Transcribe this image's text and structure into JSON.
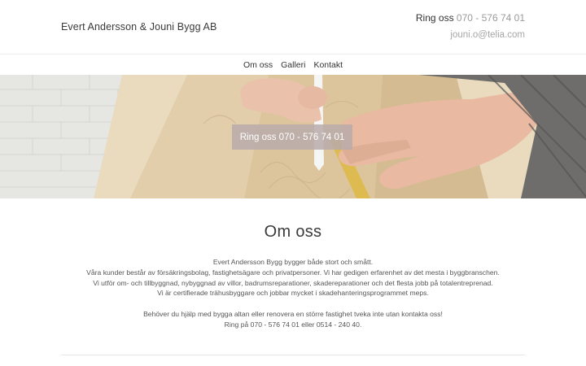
{
  "header": {
    "brand": "Evert Andersson & Jouni Bygg AB",
    "phone_label": "Ring oss",
    "phone_number": "070 - 576 74 01",
    "email": "jouni.o@telia.com"
  },
  "nav": {
    "items": [
      {
        "label": "Om oss"
      },
      {
        "label": "Galleri"
      },
      {
        "label": "Kontakt"
      }
    ]
  },
  "hero": {
    "cta_label": "Ring oss 070 - 576 74 01"
  },
  "about": {
    "title": "Om oss",
    "lines": [
      "Evert Andersson Bygg bygger både stort och smått.",
      "Våra kunder består av försäkringsbolag, fastighetsägare och privatpersoner. Vi har gedigen erfarenhet av det mesta i byggbranschen.",
      "Vi utför om- och tillbyggnad, nybyggnad av villor, badrumsreparationer, skadereparationer och det flesta jobb på totalentreprenad.",
      "Vi är certifierade trähusbyggare och jobbar mycket i skadehanteringsprogrammet meps.",
      "Behöver du hjälp med bygga altan eller renovera en större fastighet tveka inte utan kontakta oss!",
      "Ring på 070 - 576 74 01 eller 0514 - 240 40."
    ]
  },
  "colors": {
    "cta_background": "#b8aaaa",
    "muted_text": "#a6a6a6"
  }
}
